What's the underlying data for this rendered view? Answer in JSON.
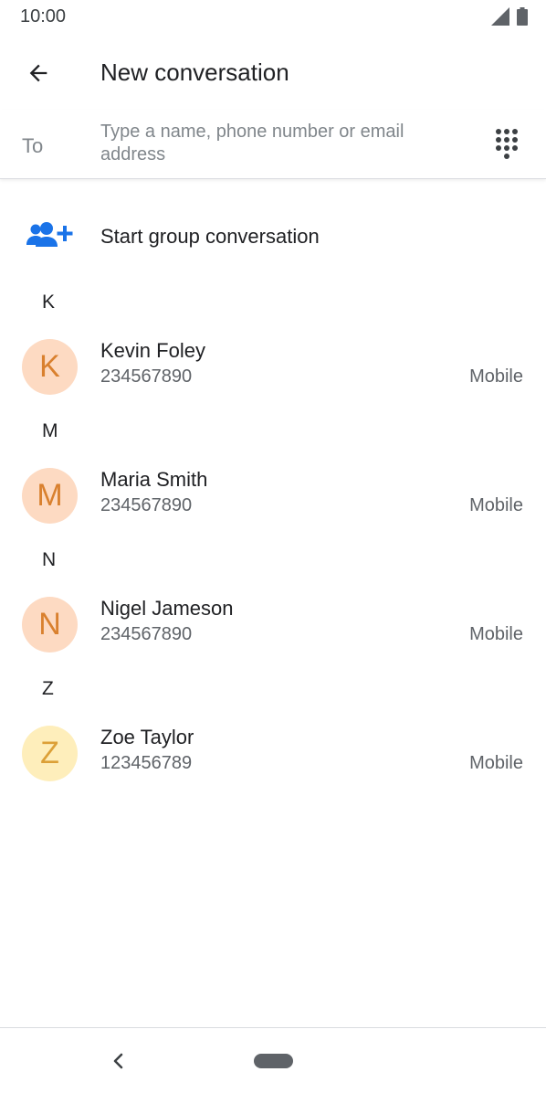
{
  "status_bar": {
    "time": "10:00"
  },
  "app_bar": {
    "title": "New conversation"
  },
  "to_field": {
    "label": "To",
    "placeholder": "Type a name, phone number or email address"
  },
  "group": {
    "label": "Start group conversation"
  },
  "colors": {
    "accent": "#1a73e8",
    "avatar_orange_bg": "#fddac2",
    "avatar_orange_fg": "#d9802e",
    "avatar_yellow_bg": "#feeebb",
    "avatar_yellow_fg": "#dca037"
  },
  "contacts": [
    {
      "section": "K",
      "initial": "K",
      "name": "Kevin Foley",
      "number": "234567890",
      "type": "Mobile"
    },
    {
      "section": "M",
      "initial": "M",
      "name": "Maria Smith",
      "number": "234567890",
      "type": "Mobile"
    },
    {
      "section": "N",
      "initial": "N",
      "name": "Nigel Jameson",
      "number": "234567890",
      "type": "Mobile"
    },
    {
      "section": "Z",
      "initial": "Z",
      "name": "Zoe Taylor",
      "number": "123456789",
      "type": "Mobile"
    }
  ]
}
